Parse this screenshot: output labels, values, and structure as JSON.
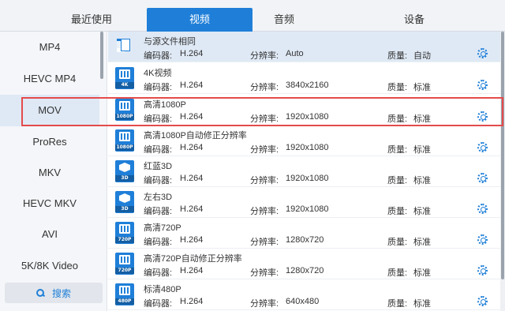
{
  "tabs": [
    {
      "label": "最近使用"
    },
    {
      "label": "视频"
    },
    {
      "label": "音频"
    },
    {
      "label": "设备"
    }
  ],
  "sidebar": {
    "items": [
      {
        "label": "MP4"
      },
      {
        "label": "HEVC MP4"
      },
      {
        "label": "MOV"
      },
      {
        "label": "ProRes"
      },
      {
        "label": "MKV"
      },
      {
        "label": "HEVC MKV"
      },
      {
        "label": "AVI"
      },
      {
        "label": "5K/8K Video"
      }
    ],
    "search_label": "搜索"
  },
  "field_labels": {
    "encoder": "编码器:",
    "resolution": "分辨率:",
    "quality": "质量:"
  },
  "presets": [
    {
      "name": "与源文件相同",
      "icon_label": "",
      "encoder": "H.264",
      "resolution": "Auto",
      "quality": "自动"
    },
    {
      "name": "4K视频",
      "icon_label": "4K",
      "encoder": "H.264",
      "resolution": "3840x2160",
      "quality": "标准"
    },
    {
      "name": "高清1080P",
      "icon_label": "1080P",
      "encoder": "H.264",
      "resolution": "1920x1080",
      "quality": "标准"
    },
    {
      "name": "高清1080P自动修正分辨率",
      "icon_label": "1080P",
      "encoder": "H.264",
      "resolution": "1920x1080",
      "quality": "标准"
    },
    {
      "name": "红蓝3D",
      "icon_label": "3D",
      "encoder": "H.264",
      "resolution": "1920x1080",
      "quality": "标准"
    },
    {
      "name": "左右3D",
      "icon_label": "3D",
      "encoder": "H.264",
      "resolution": "1920x1080",
      "quality": "标准"
    },
    {
      "name": "高清720P",
      "icon_label": "720P",
      "encoder": "H.264",
      "resolution": "1280x720",
      "quality": "标准"
    },
    {
      "name": "高清720P自动修正分辨率",
      "icon_label": "720P",
      "encoder": "H.264",
      "resolution": "1280x720",
      "quality": "标准"
    },
    {
      "name": "标清480P",
      "icon_label": "480P",
      "encoder": "H.264",
      "resolution": "640x480",
      "quality": "标准"
    }
  ],
  "colors": {
    "accent": "#1f7fd8",
    "highlight_border": "#e44b4b",
    "selected_bg": "#dfe9f5"
  }
}
